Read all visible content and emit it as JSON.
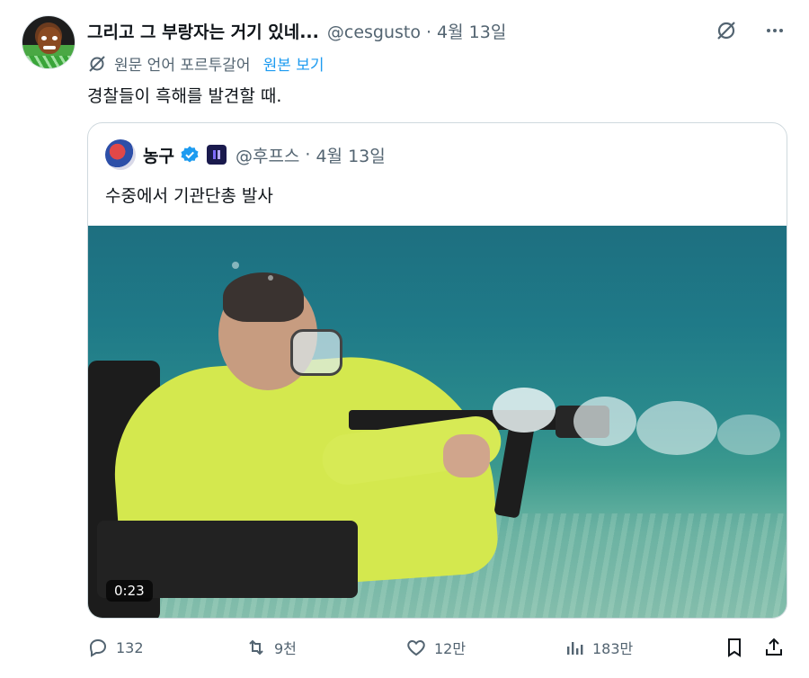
{
  "tweet": {
    "display_name": "그리고 그 부랑자는 거기 있네...",
    "handle": "@cesgusto",
    "separator": "·",
    "date": "4월 13일",
    "translate_label": "원문 언어 포르투갈어",
    "translate_link": "원본 보기",
    "text": "경찰들이 흑해를 발견할 때."
  },
  "quote": {
    "display_name": "농구",
    "handle": "@후프스",
    "separator": "·",
    "date": "4월 13일",
    "text": "수중에서 기관단총 발사",
    "video_duration": "0:23"
  },
  "actions": {
    "replies": "132",
    "reposts": "9천",
    "likes": "12만",
    "views": "183만"
  },
  "icons": [
    "grok-slash-icon",
    "more-icon",
    "translate-icon",
    "verified-badge-icon",
    "affiliate-badge-icon",
    "reply-icon",
    "repost-icon",
    "like-icon",
    "views-icon",
    "bookmark-icon",
    "share-icon"
  ],
  "colors": {
    "accent": "#1d9bf0",
    "muted": "#536471",
    "text": "#0f1419",
    "border": "#cfd9de"
  }
}
